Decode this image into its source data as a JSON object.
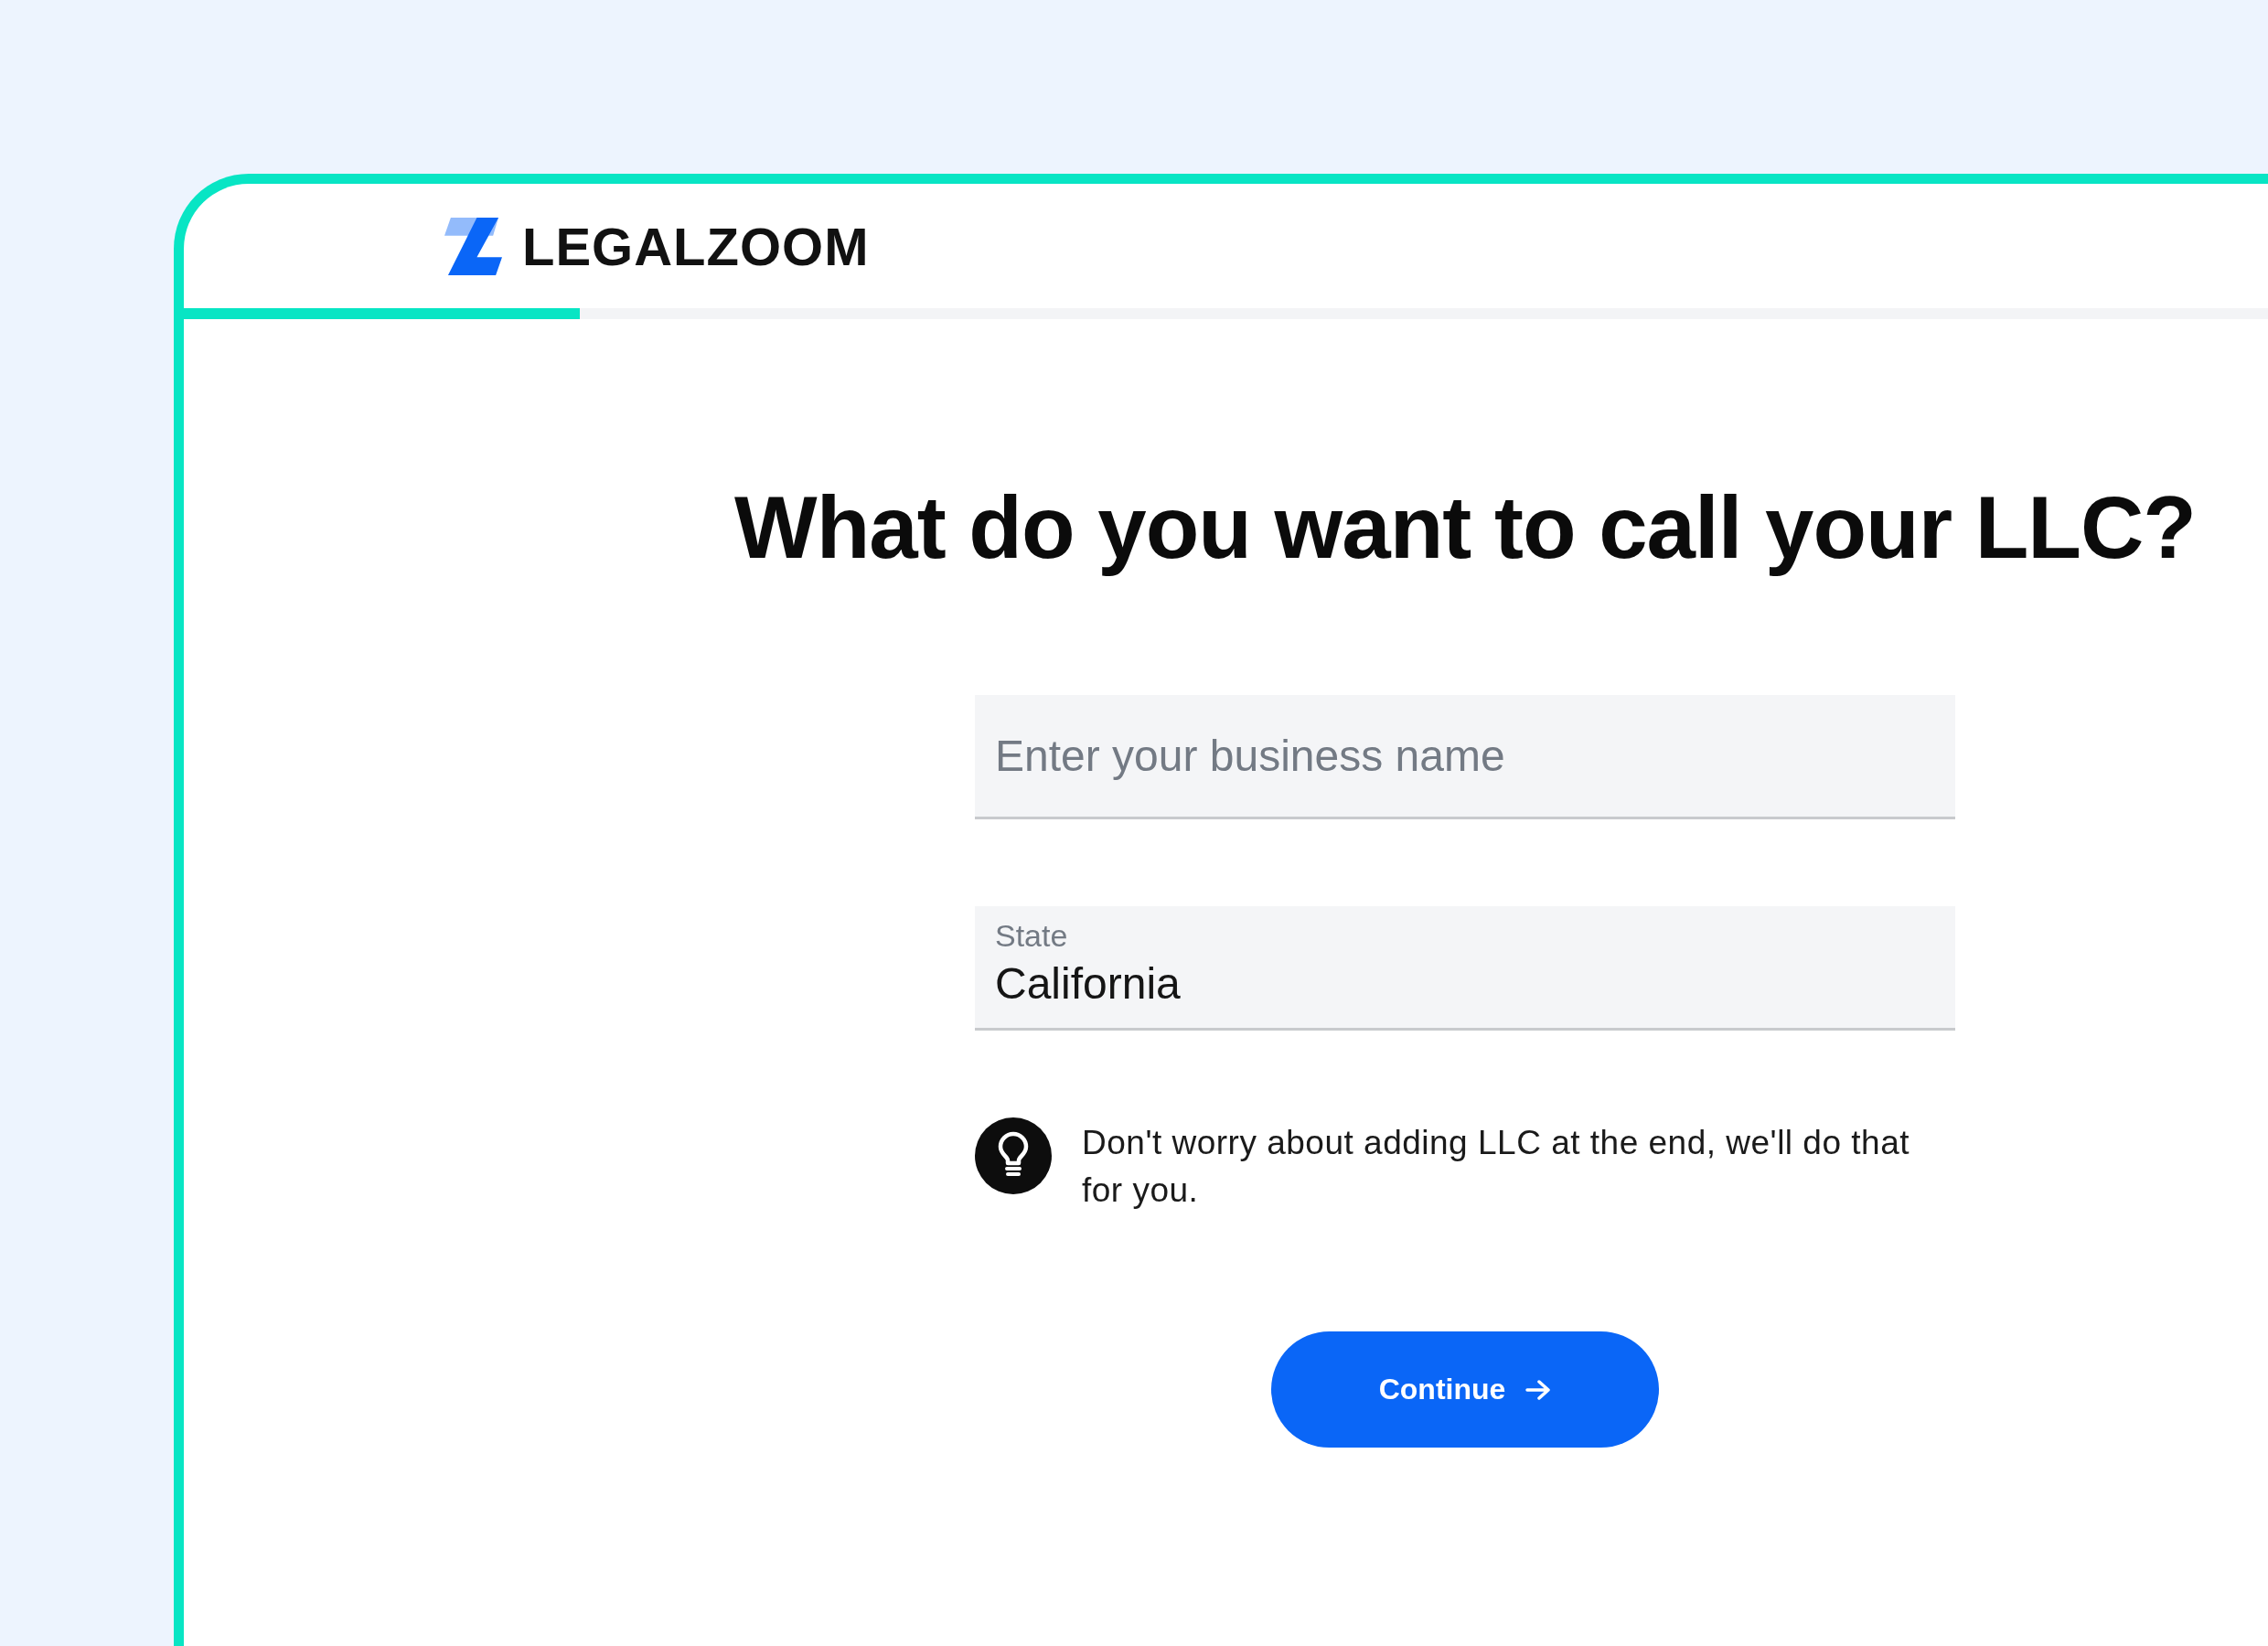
{
  "logo": {
    "text": "LEGALZOOM"
  },
  "progress": {
    "level": 0.19
  },
  "heading": "What do you want to call your LLC?",
  "fields": [
    {
      "kind": "text",
      "placeholder": "Enter your business name"
    },
    {
      "kind": "select",
      "label": "State",
      "value": "California"
    }
  ],
  "tip": {
    "text": "Don't worry about adding LLC at the end, we'll do that for you."
  },
  "button": {
    "label": "Continue"
  }
}
